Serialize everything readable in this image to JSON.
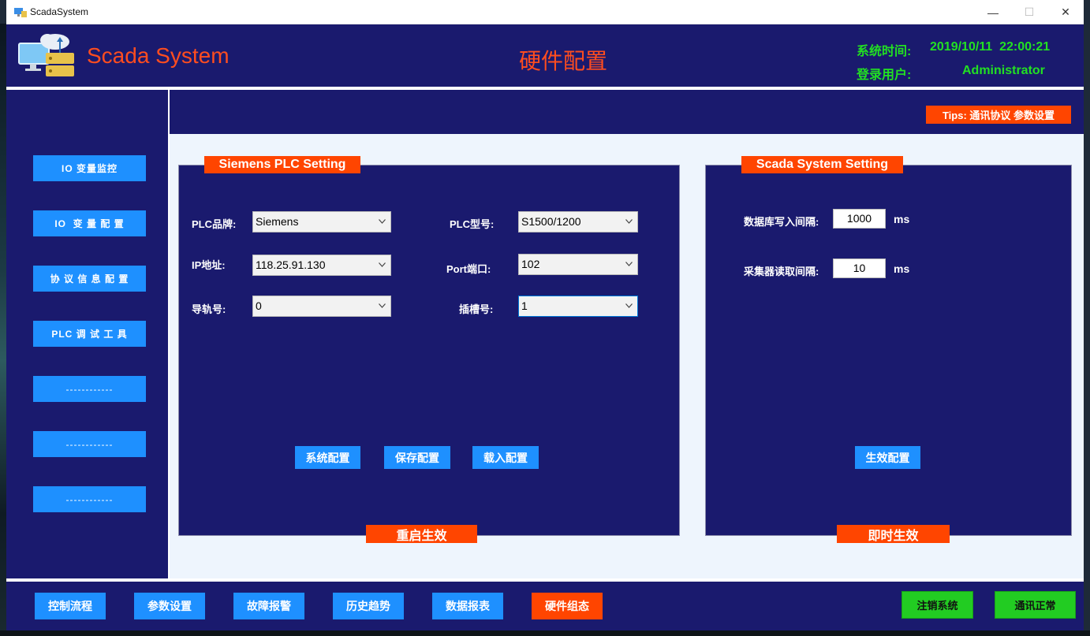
{
  "window": {
    "title": "ScadaSystem"
  },
  "header": {
    "brand": "Scada System",
    "page_title": "硬件配置",
    "system_time_label": "系统时间:",
    "system_time_value": "2019/10/11  22:00:21",
    "login_user_label": "登录用户:",
    "login_user_value": "Administrator"
  },
  "tips": "Tips: 通讯协议 参数设置",
  "sidebar": {
    "items": [
      {
        "label": "IO 变量监控"
      },
      {
        "label": "IO  变 量 配 置"
      },
      {
        "label": "协 议 信 息 配 置"
      },
      {
        "label": "PLC 调 试 工 具"
      },
      {
        "label": "------------"
      },
      {
        "label": "------------"
      },
      {
        "label": "------------"
      }
    ]
  },
  "plc_panel": {
    "title": "Siemens PLC Setting",
    "footer": "重启生效",
    "brand_label": "PLC品牌:",
    "brand_value": "Siemens",
    "model_label": "PLC型号:",
    "model_value": "S1500/1200",
    "ip_label": "IP地址:",
    "ip_value": "118.25.91.130",
    "port_label": "Port端口:",
    "port_value": "102",
    "rack_label": "导轨号:",
    "rack_value": "0",
    "slot_label": "插槽号:",
    "slot_value": "1",
    "buttons": {
      "system_config": "系统配置",
      "save_config": "保存配置",
      "load_config": "载入配置"
    }
  },
  "scada_panel": {
    "title": "Scada System Setting",
    "footer": "即时生效",
    "db_write_label": "数据库写入间隔:",
    "db_write_value": "1000",
    "db_write_unit": "ms",
    "collector_label": "采集器读取间隔:",
    "collector_value": "10",
    "collector_unit": "ms",
    "apply_button": "生效配置"
  },
  "bottom_nav": {
    "tabs": [
      {
        "label": "控制流程"
      },
      {
        "label": "参数设置"
      },
      {
        "label": "故障报警"
      },
      {
        "label": "历史趋势"
      },
      {
        "label": "数据报表"
      },
      {
        "label": "硬件组态"
      }
    ],
    "logout": "注销系统",
    "comm_status": "通讯正常"
  },
  "colors": {
    "background": "#1a1a6e",
    "accent_orange": "#ff4500",
    "button_blue": "#1e90ff",
    "status_green": "#22e022"
  }
}
